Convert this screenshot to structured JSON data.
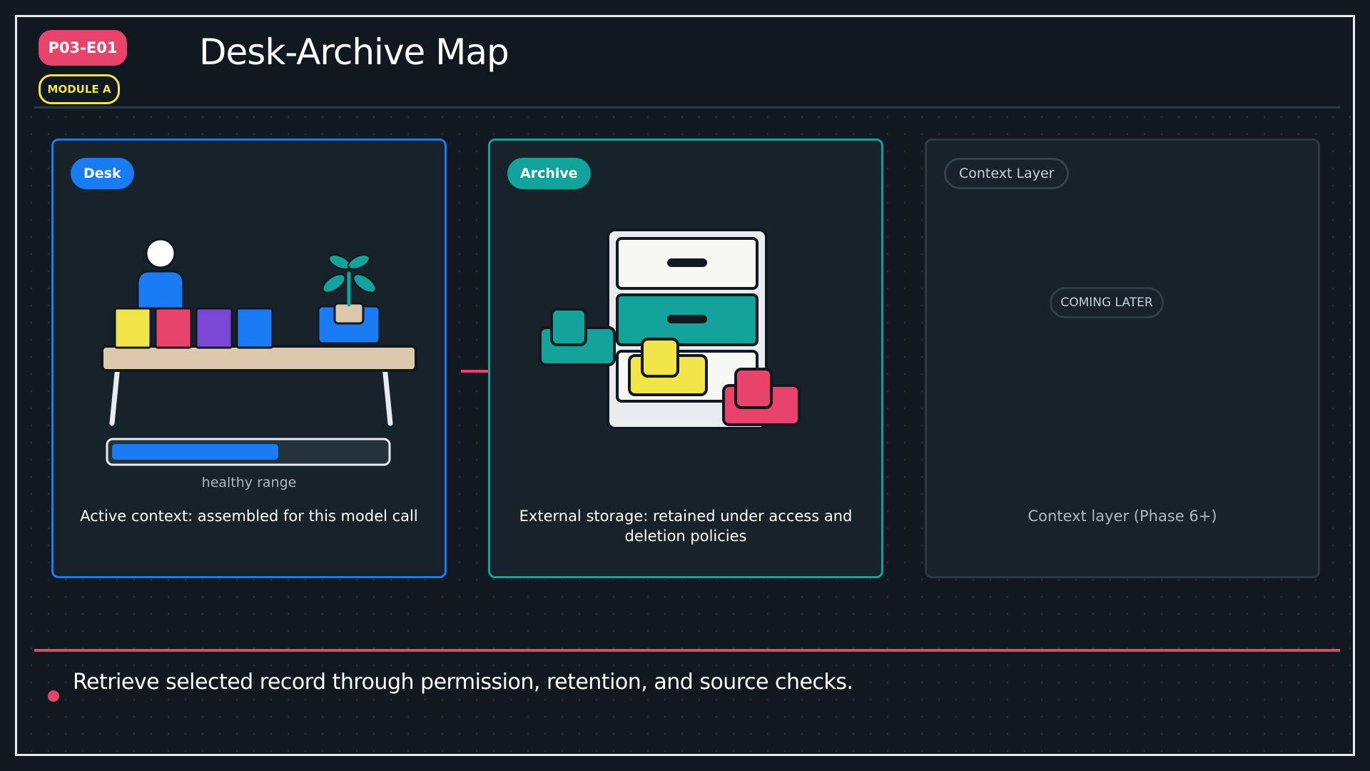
{
  "header": {
    "id_badge": "P03-E01",
    "module_badge": "MODULE A",
    "title": "Desk-Archive Map"
  },
  "panels": {
    "desk": {
      "chip": "Desk",
      "progress_label": "healthy range",
      "progress_fraction": 0.61,
      "caption": "Active context: assembled for this model call"
    },
    "archive": {
      "chip": "Archive",
      "caption": "External storage: retained under access and deletion policies"
    },
    "context": {
      "chip": "Context Layer",
      "status": "COMING LATER",
      "caption": "Context layer (Phase 6+)"
    }
  },
  "footer": {
    "bullet": "Retrieve selected record through permission, retention, and source checks."
  },
  "colors": {
    "background": "#111820",
    "accent_red": "#e8436a",
    "accent_blue": "#1a7cf4",
    "accent_teal": "#14a39a",
    "accent_yellow": "#f2e54a",
    "accent_purple": "#7b47d6"
  },
  "icons": [
    "person-icon",
    "plant-icon",
    "desk-icon",
    "filing-cabinet-icon",
    "folder-icon",
    "arrow-right-icon"
  ]
}
